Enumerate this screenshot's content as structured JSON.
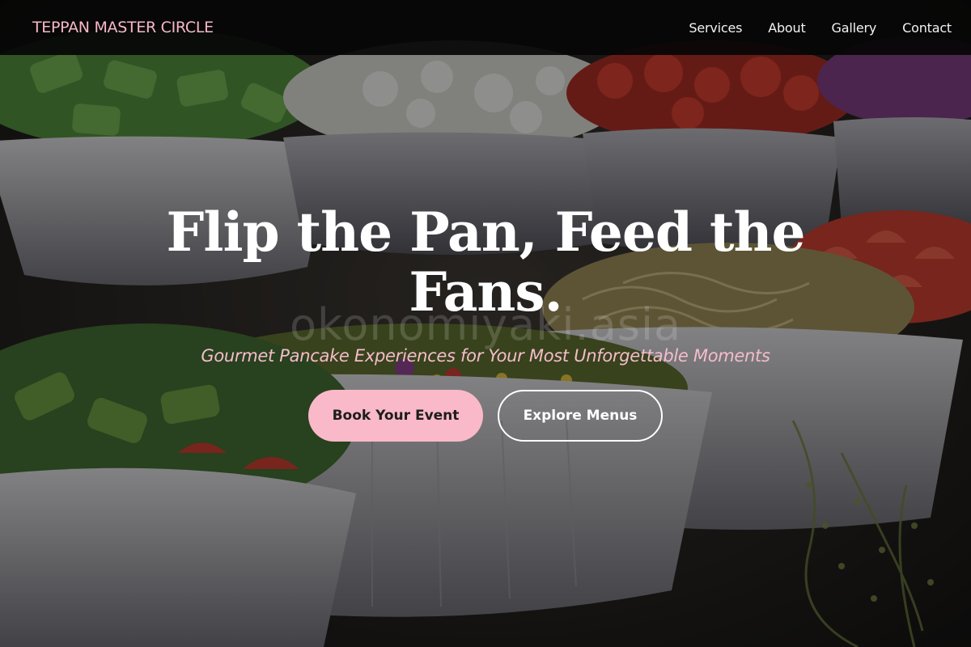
{
  "brand": {
    "name": "TEPPAN MASTER CIRCLE"
  },
  "nav": {
    "items": [
      {
        "label": "Services"
      },
      {
        "label": "About"
      },
      {
        "label": "Gallery"
      },
      {
        "label": "Contact"
      }
    ]
  },
  "hero": {
    "title": "Flip the Pan, Feed the Fans.",
    "subtitle": "Gourmet Pancake Experiences for Your Most Unforgettable Moments",
    "watermark": "okonomiyaki.asia",
    "primary_button": "Book Your Event",
    "secondary_button": "Explore Menus"
  },
  "colors": {
    "accent_pink": "#f9b9c9",
    "navbar_bg": "#060606",
    "text_white": "#ffffff"
  },
  "background": {
    "icon": "food-bowls-photo"
  }
}
